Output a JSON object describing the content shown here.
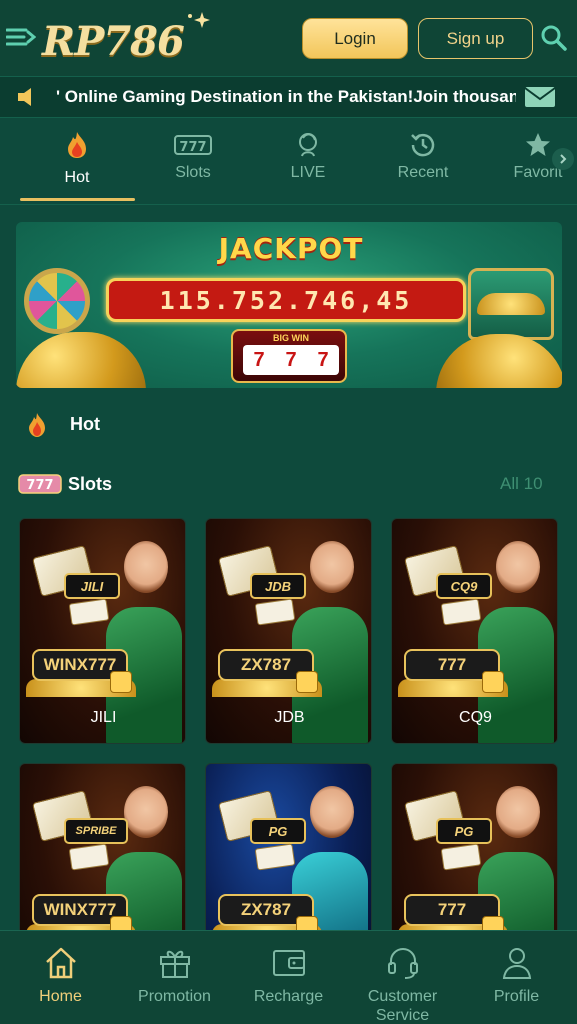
{
  "header": {
    "logo_text": "RP786",
    "login_label": "Login",
    "signup_label": "Sign up"
  },
  "marquee": {
    "text": "' Online Gaming Destination in the Pakistan!Join thousan"
  },
  "tabs": [
    {
      "label": "Hot",
      "icon": "flame-icon",
      "active": true
    },
    {
      "label": "Slots",
      "icon": "slot-777-icon",
      "active": false
    },
    {
      "label": "LIVE",
      "icon": "live-dealer-icon",
      "active": false
    },
    {
      "label": "Recent",
      "icon": "history-icon",
      "active": false
    },
    {
      "label": "Favorit",
      "icon": "star-icon",
      "active": false
    }
  ],
  "banner": {
    "title": "JACKPOT",
    "amount": "115.752.746,45",
    "bigwin_label": "BIG WIN",
    "reels": [
      "7",
      "7",
      "7"
    ]
  },
  "sections": {
    "hot_label": "Hot",
    "slots_label": "Slots",
    "slots_all": "All 10"
  },
  "games": [
    {
      "name": "JILI",
      "provider": "JILI",
      "badge": "WINX777"
    },
    {
      "name": "JDB",
      "provider": "JDB",
      "badge": "ZX787"
    },
    {
      "name": "CQ9",
      "provider": "CQ9",
      "badge": "777"
    },
    {
      "name": "",
      "provider": "SPRIBE",
      "badge": "WINX777"
    },
    {
      "name": "",
      "provider": "PG",
      "badge": "ZX787"
    },
    {
      "name": "",
      "provider": "PG",
      "badge": "777"
    }
  ],
  "bottom_nav": [
    {
      "label": "Home",
      "icon": "home-icon",
      "active": true
    },
    {
      "label": "Promotion",
      "icon": "gift-icon",
      "active": false
    },
    {
      "label": "Recharge",
      "icon": "wallet-icon",
      "active": false
    },
    {
      "label": "Customer Service",
      "icon": "headset-icon",
      "active": false
    },
    {
      "label": "Profile",
      "icon": "user-icon",
      "active": false
    }
  ],
  "colors": {
    "background": "#0e4a3c",
    "accent_gold": "#e8c060",
    "inactive_text": "#7fb8a4"
  }
}
